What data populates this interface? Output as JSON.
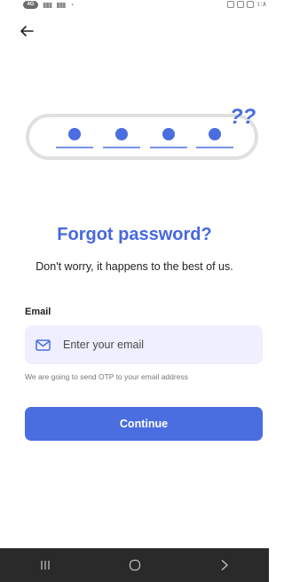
{
  "status_bar": {
    "carrier_badge": "4G",
    "clock": "١:٨"
  },
  "header": {
    "back_icon": "arrow-left-icon"
  },
  "illustration": {
    "otp_dots": 4,
    "question_marks": "??",
    "colors": {
      "dot": "#4a6ee0",
      "question": "#4a6ee0",
      "frame": "#e0e0e0"
    }
  },
  "main": {
    "title": "Forgot password?",
    "subtitle": "Don't worry, it happens to the best of us."
  },
  "form": {
    "email_label": "Email",
    "email_placeholder": "Enter your email",
    "email_value": "",
    "helper_text": "We are going to send OTP to your email address",
    "continue_label": "Continue"
  },
  "nav_bar": {
    "buttons": [
      "recent-apps-icon",
      "home-icon",
      "back-chevron-icon"
    ]
  },
  "colors": {
    "accent": "#4a6ee0",
    "title": "#4868df",
    "field_bg": "#efefff",
    "nav_bg": "#2a2a2a"
  }
}
